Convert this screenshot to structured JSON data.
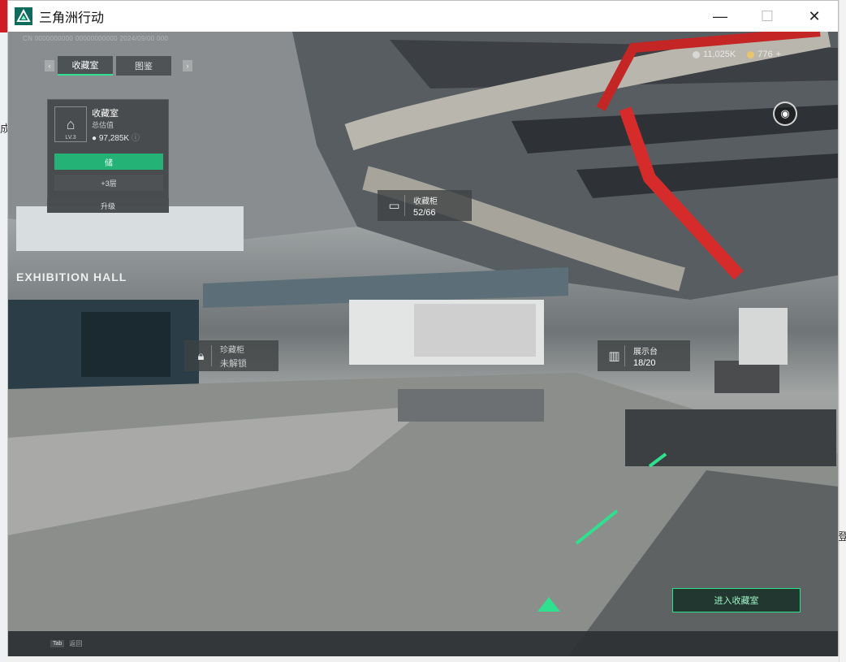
{
  "window": {
    "title": "三角洲行动",
    "minimize": "—",
    "maximize": "☐",
    "close": "✕"
  },
  "desktop": {
    "left_fragment": "成",
    "right_fragment": "登"
  },
  "hud": {
    "build_info": "CN 0000000000 00000000000 2024/09/00 000",
    "tabs": [
      {
        "label": "收藏室",
        "active": true
      },
      {
        "label": "图鉴",
        "active": false
      }
    ],
    "tab_prev": "‹",
    "tab_next": "›",
    "currency": [
      {
        "value": "11,025K",
        "color": "#d8d8d8"
      },
      {
        "value": "776",
        "color": "#e9c46a"
      }
    ],
    "currency_add": "+",
    "panel": {
      "title": "收藏室",
      "subtitle": "总估值",
      "value": "97,285K",
      "level": "LV.3",
      "primary_label": "储",
      "secondary_label": "+3层",
      "upgrade_label": "升级"
    },
    "poi": [
      {
        "title": "收藏柜",
        "value": "52/66",
        "locked": false
      },
      {
        "title": "珍藏柜",
        "value": "未解锁",
        "locked": true
      },
      {
        "title": "展示台",
        "value": "18/20",
        "locked": false
      }
    ],
    "scene_sign": "EXHIBITION HALL",
    "enter_button": "进入收藏室",
    "bottom_key": "Tab",
    "bottom_label": "返回",
    "accent": "#2fe08f"
  }
}
